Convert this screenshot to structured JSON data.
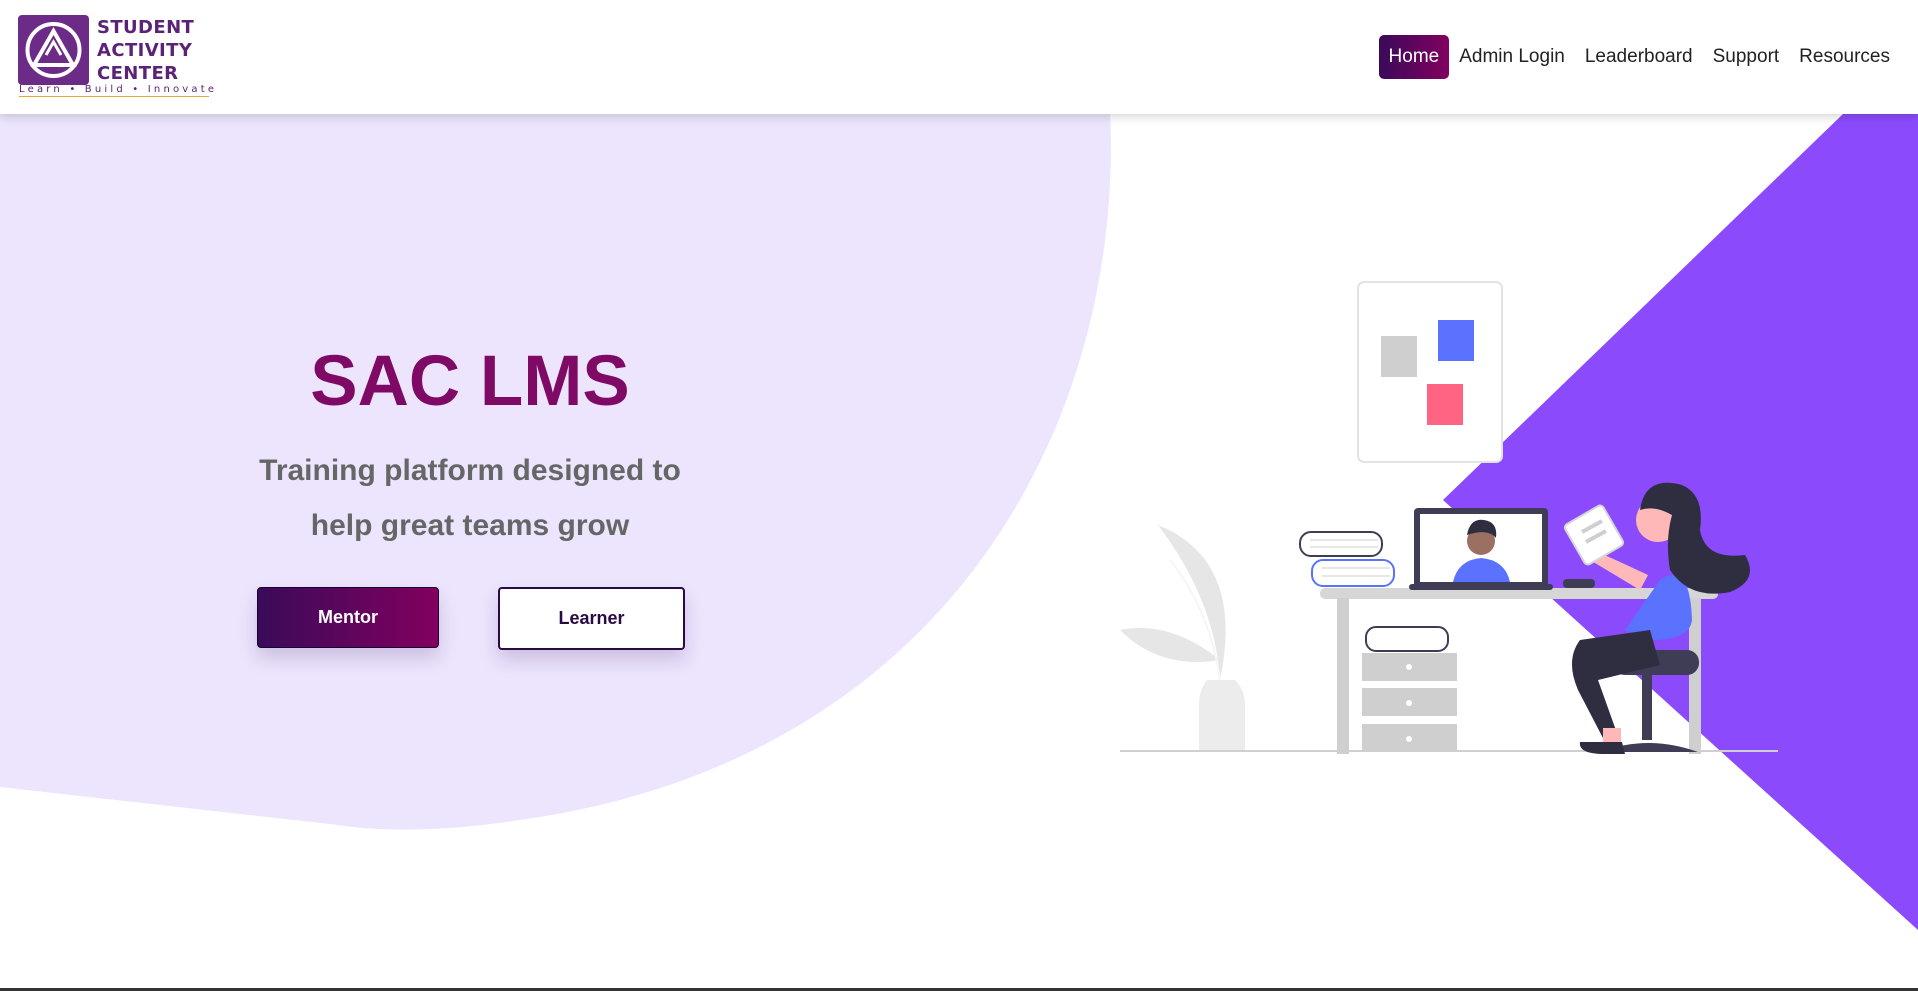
{
  "colors": {
    "brand_purple": "#5b2377",
    "title_magenta": "#7e0a66",
    "button_gradient_start": "#3a0a5a",
    "button_gradient_end": "#82005f",
    "blob_lavender": "#ece5fd",
    "triangle_violet": "#8b4bfc",
    "subtitle_gray": "#666666"
  },
  "logo": {
    "line1": "STUDENT",
    "line2": "ACTIVITY",
    "line3": "CENTER",
    "tagline": "Learn • Build • Innovate"
  },
  "nav": {
    "items": [
      {
        "label": "Home",
        "active": true
      },
      {
        "label": "Admin Login",
        "active": false
      },
      {
        "label": "Leaderboard",
        "active": false
      },
      {
        "label": "Support",
        "active": false
      },
      {
        "label": "Resources",
        "active": false
      }
    ]
  },
  "hero": {
    "title": "SAC LMS",
    "subtitle_line1": "Training platform designed to",
    "subtitle_line2": "help great teams grow",
    "mentor_button": "Mentor",
    "learner_button": "Learner"
  },
  "illustration": {
    "icon": "remote-learning-illustration"
  }
}
